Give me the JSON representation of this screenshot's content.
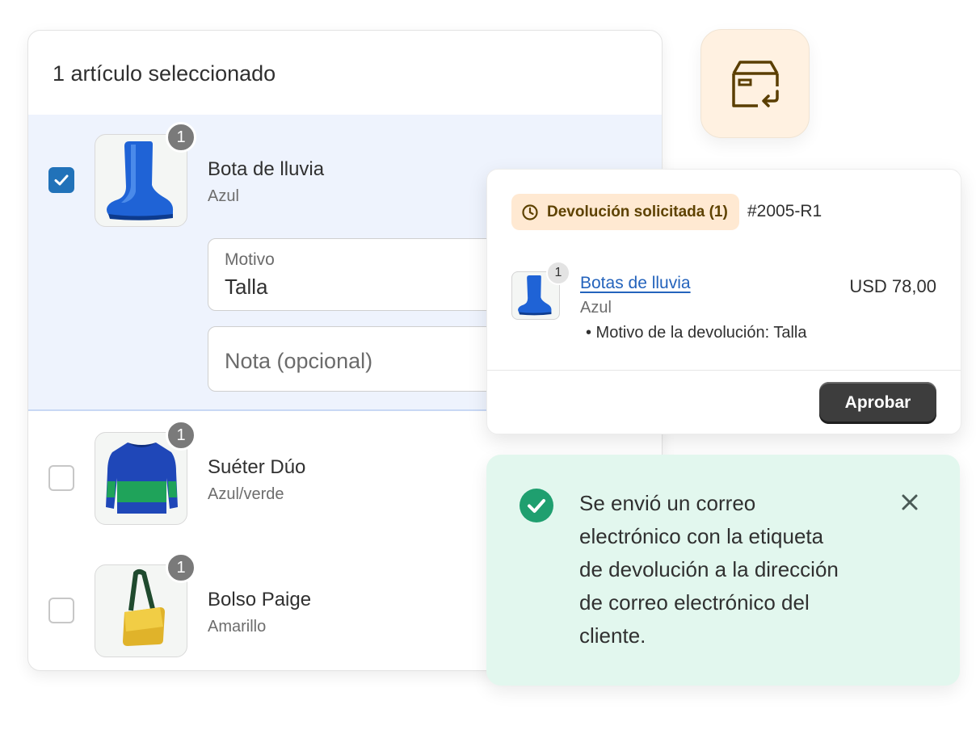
{
  "selection": {
    "title": "1 artículo seleccionado",
    "items": [
      {
        "name": "Bota de lluvia",
        "variant": "Azul",
        "quantity": "1",
        "checked": true
      },
      {
        "name": "Suéter Dúo",
        "variant": "Azul/verde",
        "quantity": "1",
        "checked": false
      },
      {
        "name": "Bolso Paige",
        "variant": "Amarillo",
        "quantity": "1",
        "checked": false
      }
    ],
    "reason_field": {
      "label": "Motivo",
      "value": "Talla"
    },
    "note_field": {
      "placeholder": "Nota (opcional)"
    }
  },
  "return_request": {
    "status_label": "Devolución solicitada (1)",
    "order_id": "#2005-R1",
    "product": {
      "name": "Botas de lluvia",
      "variant": "Azul",
      "quantity": "1",
      "reason": "• Motivo de la devolución: Talla",
      "price": "USD 78,00"
    },
    "approve_label": "Aprobar"
  },
  "toast": {
    "message": "Se envió un correo electrónico con la etiqueta de devolución a la dirección de correo electrónico del cliente."
  },
  "colors": {
    "accent_blue": "#2172b9",
    "link_blue": "#2463bc",
    "selected_row_bg": "#eef3fd",
    "status_pill_bg": "#ffe9d2",
    "toast_bg": "#e2f7ee",
    "success_green": "#1f9f6f"
  }
}
